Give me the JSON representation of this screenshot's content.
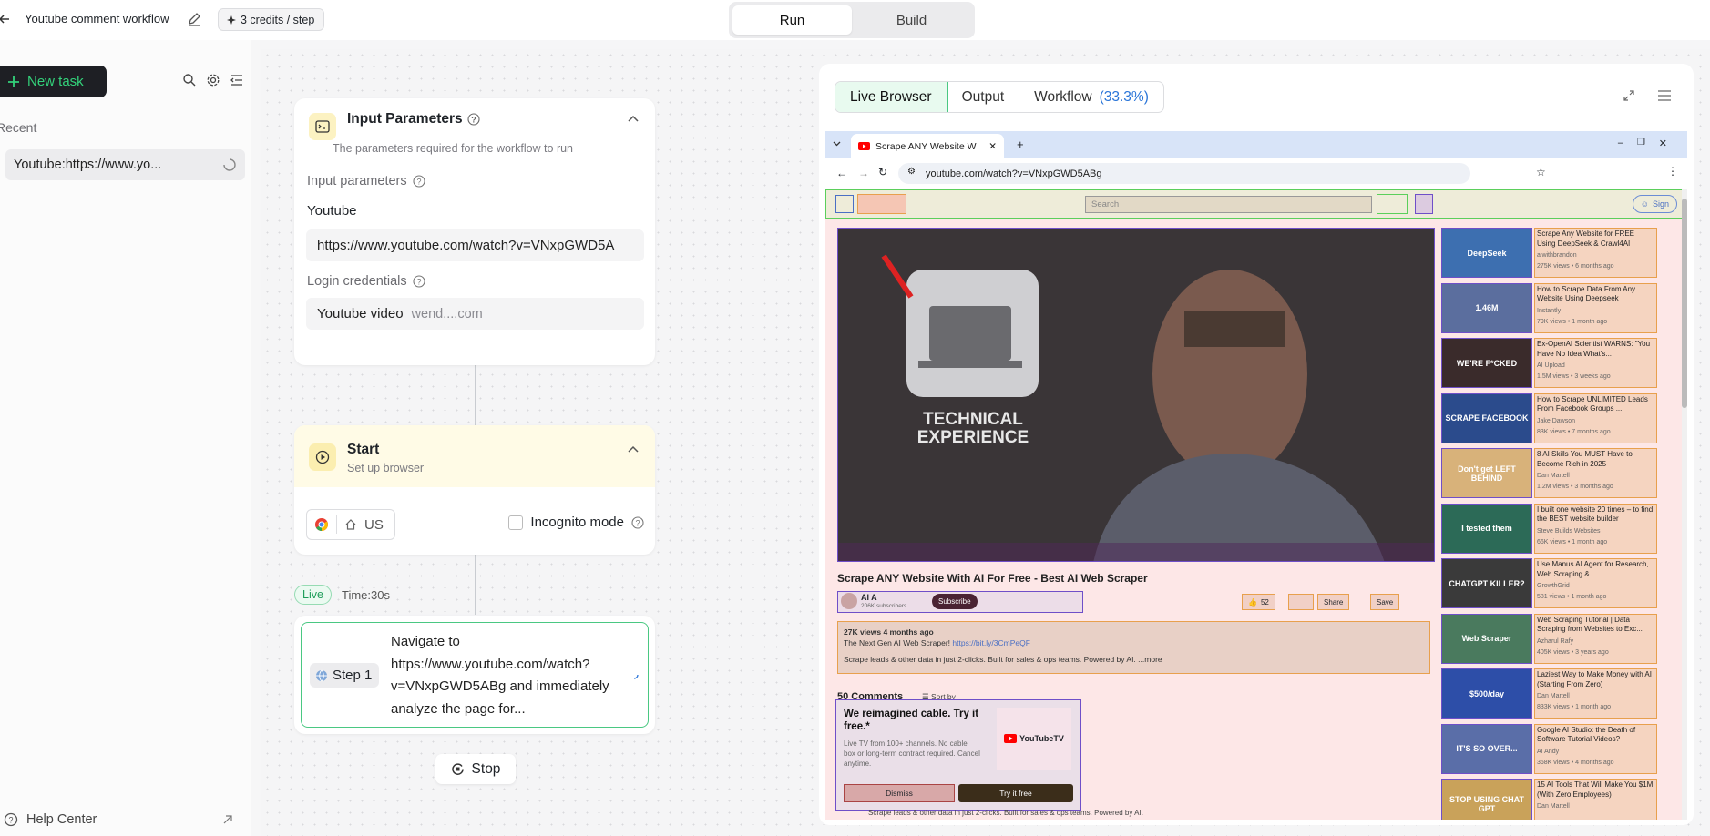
{
  "header": {
    "title": "Youtube comment workflow",
    "credits": "3 credits / step",
    "modes": [
      "Run",
      "Build"
    ],
    "active_mode": "Run"
  },
  "sidebar": {
    "new_task": "New task",
    "recent_label": "Recent",
    "tasks": [
      {
        "label": "Youtube:https://www.yo..."
      }
    ],
    "help": "Help Center"
  },
  "input_params": {
    "title": "Input Parameters",
    "subtitle": "The parameters required for the workflow to run",
    "section_label": "Input parameters",
    "param_name": "Youtube",
    "param_value": "https://www.youtube.com/watch?v=VNxpGWD5A",
    "login_label": "Login credentials",
    "login_name": "Youtube video",
    "login_value": "wend....com"
  },
  "start": {
    "title": "Start",
    "subtitle": "Set up browser",
    "region": "US",
    "incognito_label": "Incognito mode"
  },
  "run_status": {
    "badge": "Live",
    "time": "Time:30s"
  },
  "step": {
    "label": "Step 1",
    "text": "Navigate to https://www.youtube.com/watch?v=VNxpGWD5ABg and immediately analyze the page for..."
  },
  "stop_label": "Stop",
  "panel": {
    "tabs": [
      "Live Browser",
      "Output",
      "Workflow"
    ],
    "active_tab": "Live Browser",
    "workflow_progress": "(33.3%)"
  },
  "browser": {
    "tab_title": "Scrape ANY Website W",
    "url": "youtube.com/watch?v=VNxpGWD5ABg",
    "search_placeholder": "Search",
    "sign_in": "Sign",
    "video_overlay": "TECHNICAL EXPERIENCE",
    "video_title": "Scrape ANY Website With AI For Free - Best AI Web Scraper",
    "channel": "AI A",
    "subscribers": "206K subscribers",
    "subscribe": "Subscribe",
    "likes": "52",
    "share": "Share",
    "save": "Save",
    "views_line": "27K views  4 months ago",
    "desc_line1": "The Next Gen AI Web Scraper!",
    "desc_link": "https://bit.ly/3CmPeQF",
    "desc_line2": "Scrape leads & other data in just 2-clicks. Built for sales & ops teams. Powered by AI.",
    "desc_more": "...more",
    "comments_count": "50 Comments",
    "sort_by": "Sort by",
    "ad_title": "We reimagined cable. Try it free.*",
    "ad_text": "Live TV from 100+ channels. No cable box or long-term contract required. Cancel anytime.",
    "ad_brand": "YouTubeTV",
    "ad_dismiss": "Dismiss",
    "ad_try": "Try it free",
    "bottom_text": "Scrape leads & other data in just 2-clicks. Built for sales & ops teams. Powered by AI.",
    "recommendations": [
      {
        "title": "Scrape Any Website for FREE Using DeepSeek & Crawl4AI",
        "author": "aiwithbrandon",
        "meta": "275K views • 6 months ago",
        "thumb": "DeepSeek",
        "color": "#3d6fb0"
      },
      {
        "title": "How to Scrape Data From Any Website Using Deepseek",
        "author": "Instantly",
        "meta": "79K views • 1 month ago",
        "thumb": "1.46M",
        "color": "#5b6e9e"
      },
      {
        "title": "Ex-OpenAI Scientist WARNS: \"You Have No Idea What's...",
        "author": "AI Upload",
        "meta": "1.5M views • 3 weeks ago",
        "thumb": "WE'RE F*CKED",
        "color": "#3a2b2b"
      },
      {
        "title": "How to Scrape UNLIMITED Leads From Facebook Groups ...",
        "author": "Jake Dawson",
        "meta": "83K views • 7 months ago",
        "thumb": "SCRAPE FACEBOOK",
        "color": "#2b4b8c"
      },
      {
        "title": "8 AI Skills You MUST Have to Become Rich in 2025",
        "author": "Dan Martell",
        "meta": "1.2M views • 3 months ago",
        "thumb": "Don't get LEFT BEHIND",
        "color": "#d8b27a"
      },
      {
        "title": "I built one website 20 times – to find the BEST website builder",
        "author": "Steve Builds Websites",
        "meta": "66K views • 1 month ago",
        "thumb": "I tested them",
        "color": "#2c6a57"
      },
      {
        "title": "Use Manus AI Agent for Research, Web Scraping & ...",
        "author": "GrowthGrid",
        "meta": "581 views • 1 month ago",
        "thumb": "CHATGPT KILLER?",
        "color": "#3a3a3a"
      },
      {
        "title": "Web Scraping Tutorial | Data Scraping from Websites to Exc...",
        "author": "Azharul Rafy",
        "meta": "405K views • 3 years ago",
        "thumb": "Web Scraper",
        "color": "#4a7a5e"
      },
      {
        "title": "Laziest Way to Make Money with AI (Starting From Zero)",
        "author": "Dan Martell",
        "meta": "833K views • 1 month ago",
        "thumb": "$500/day",
        "color": "#2d4ea8"
      },
      {
        "title": "Google AI Studio: the Death of Software Tutorial Videos?",
        "author": "AI Andy",
        "meta": "368K views • 4 months ago",
        "thumb": "IT'S SO OVER...",
        "color": "#5a6ea8"
      },
      {
        "title": "15 AI Tools That Will Make You $1M (With Zero Employees)",
        "author": "Dan Martell",
        "meta": "",
        "thumb": "STOP USING CHAT GPT",
        "color": "#c9a25a"
      }
    ]
  },
  "colors": {
    "accent_green": "#33d17a",
    "live_green": "#4ac882",
    "progress_blue": "#2a75d8"
  }
}
